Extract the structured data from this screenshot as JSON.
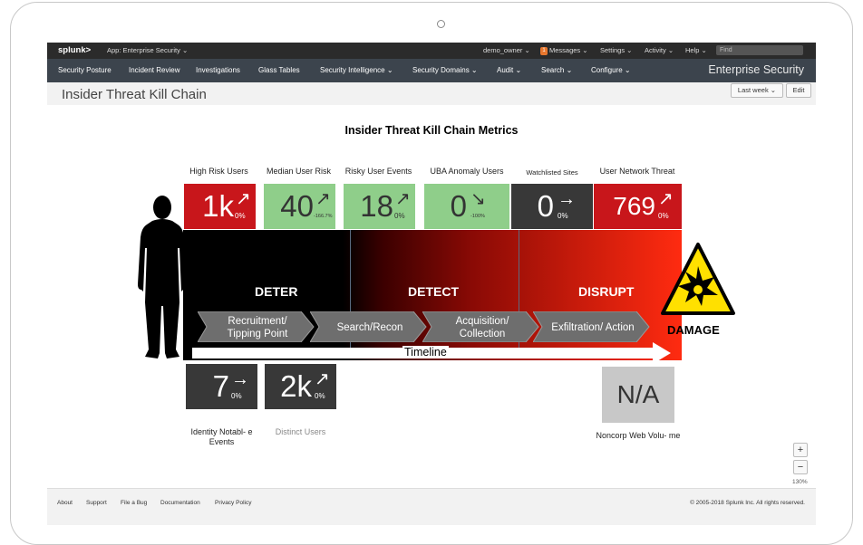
{
  "appbar": {
    "logo": "splunk>",
    "app": "App: Enterprise Security ⌄",
    "user": "demo_owner ⌄",
    "messages_count": "1",
    "messages": "Messages ⌄",
    "settings": "Settings ⌄",
    "activity": "Activity ⌄",
    "help": "Help ⌄",
    "find_placeholder": "Find"
  },
  "nav": {
    "items": [
      "Security Posture",
      "Incident Review",
      "Investigations",
      "Glass Tables",
      "Security Intelligence ⌄",
      "Security Domains ⌄",
      "Audit ⌄",
      "Search ⌄",
      "Configure ⌄"
    ],
    "product": "Enterprise Security"
  },
  "page": {
    "title": "Insider Threat Kill Chain",
    "time_range": "Last week ⌄",
    "edit": "Edit"
  },
  "glass": {
    "heading": "Insider Threat Kill Chain Metrics",
    "top_metrics": [
      {
        "label": "High Risk Users",
        "value": "1k",
        "arrow": "↗",
        "pct": "0%",
        "bg": "#c8161b",
        "fg": "#ffffff"
      },
      {
        "label": "Median User Risk",
        "value": "40",
        "arrow": "↗",
        "pct": "-166.7%",
        "bg": "#8fce8a",
        "fg": "#333333"
      },
      {
        "label": "Risky User Events",
        "value": "18",
        "arrow": "↗",
        "pct": "0%",
        "bg": "#8fce8a",
        "fg": "#333333"
      },
      {
        "label": "UBA Anomaly Users",
        "value": "0",
        "arrow": "↘",
        "pct": "-100%",
        "bg": "#8fce8a",
        "fg": "#333333"
      },
      {
        "label": "Watchlisted Sites",
        "value": "0",
        "arrow": "→",
        "pct": "0%",
        "bg": "#383838",
        "fg": "#ffffff"
      },
      {
        "label": "User Network Threat",
        "value": "769",
        "arrow": "↗",
        "pct": "0%",
        "bg": "#c8161b",
        "fg": "#ffffff"
      }
    ],
    "phases": [
      "DETER",
      "DETECT",
      "DISRUPT"
    ],
    "stages": [
      "Recruitment/ Tipping Point",
      "Search/Recon",
      "Acquisition/ Collection",
      "Exfiltration/ Action"
    ],
    "timeline": "Timeline",
    "damage": "DAMAGE",
    "bottom_metrics": [
      {
        "label": "Identity Notabl- e Events",
        "value": "7",
        "arrow": "→",
        "pct": "0%",
        "bg": "#383838",
        "fg": "#ffffff"
      },
      {
        "label": "Distinct Users",
        "value": "2k",
        "arrow": "↗",
        "pct": "0%",
        "bg": "#383838",
        "fg": "#ffffff"
      },
      {
        "label": "Noncorp Web Volu- me",
        "value": "N/A",
        "bg": "#c8c8c8",
        "fg": "#333333"
      }
    ],
    "zoom": {
      "in": "+",
      "out": "−",
      "level": "130%"
    }
  },
  "footer": {
    "links": [
      "About",
      "Support",
      "File a Bug",
      "Documentation",
      "Privacy Policy"
    ],
    "copyright": "© 2005-2018 Splunk Inc. All rights reserved."
  }
}
